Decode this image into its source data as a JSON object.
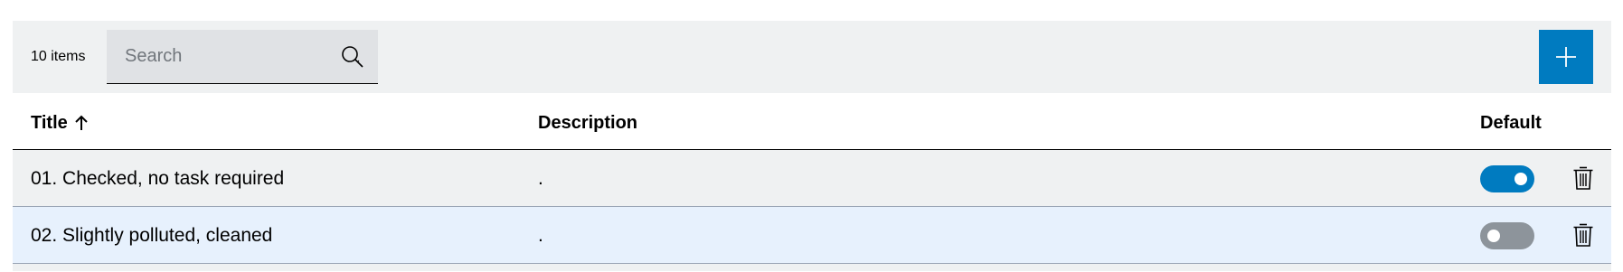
{
  "toolbar": {
    "item_count": "10 items",
    "search_placeholder": "Search",
    "search_value": ""
  },
  "table": {
    "columns": {
      "title": "Title",
      "description": "Description",
      "default": "Default"
    },
    "sort": {
      "column": "title",
      "direction": "ascending",
      "icon": "arrow-up-icon"
    },
    "rows": [
      {
        "title": "01. Checked, no task required",
        "description": ".",
        "default": true
      },
      {
        "title": "02. Slightly polluted, cleaned",
        "description": ".",
        "default": false
      }
    ]
  },
  "colors": {
    "accent": "#007bc0",
    "toggle_off": "#8d949b",
    "row_highlight": "#e7f1fd",
    "toolbar_bg": "#eff1f2"
  },
  "icons": {
    "search": "search-icon",
    "add": "plus-icon",
    "delete": "trash-icon"
  }
}
